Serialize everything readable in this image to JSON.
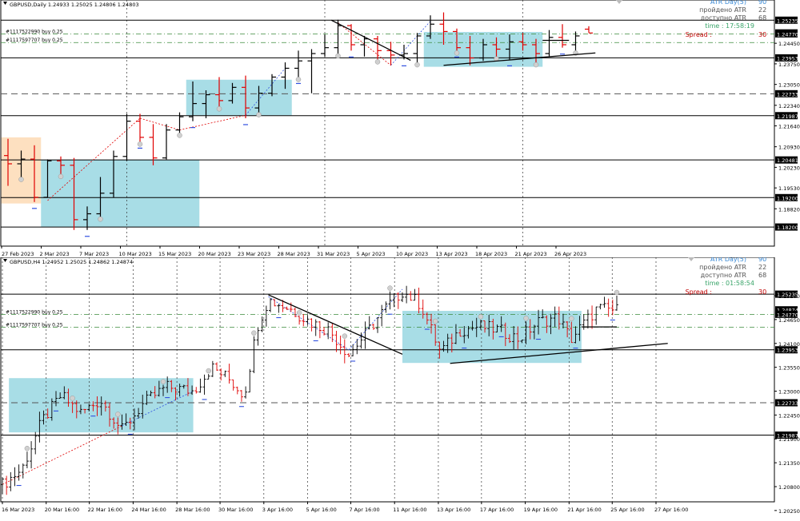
{
  "colors": {
    "bull": "#000000",
    "bear": "#e00000",
    "zone_teal": "#a8dde6",
    "zone_orange": "#fde0c0",
    "hline_solid": "#000000",
    "hline_dash": "#555555",
    "hline_green_dashdot": "#3a8a3a",
    "price_label_bg": "#000000",
    "atr_blue": "#3a8ad6",
    "time_green": "#3aa56a",
    "spread_red": "#c00000",
    "grid": "#333333"
  },
  "pane_top": {
    "title": "GBPUSD,Daily  1.24933 1.25025 1.24806 1.24803",
    "orders": [
      "#1117522990 buy 0.25",
      "#1117597707 buy 0.25"
    ],
    "info": {
      "atr_label": "ATR Day(5)",
      "atr_value": "90",
      "passed_label": "пройдено ATR",
      "passed_value": "22",
      "avail_label": "доступно ATR",
      "avail_value": "68",
      "time_text": "time : 17:58:19",
      "spread_label": "Spread :",
      "spread_value": "30"
    },
    "price_min": 1.1755,
    "price_max": 1.2565,
    "price_ticks": [
      "1.24450",
      "1.23750",
      "1.23050",
      "1.22340",
      "1.21640",
      "1.20930",
      "1.20230",
      "1.19530",
      "1.18820"
    ],
    "price_labels": [
      {
        "price": 1.25235,
        "text": "1.25235"
      },
      {
        "price": 1.24803,
        "text": "1.24803"
      },
      {
        "price": 1.2477,
        "text": "1.24770"
      },
      {
        "price": 1.23953,
        "text": "1.23953"
      },
      {
        "price": 1.22733,
        "text": "1.22733"
      },
      {
        "price": 1.21987,
        "text": "1.21987"
      },
      {
        "price": 1.20481,
        "text": "1.20481"
      },
      {
        "price": 1.192,
        "text": "1.19200"
      },
      {
        "price": 1.182,
        "text": "1.18200"
      }
    ],
    "hlines": [
      {
        "price": 1.25235,
        "style": "solid"
      },
      {
        "price": 1.23953,
        "style": "solid"
      },
      {
        "price": 1.22733,
        "style": "dash"
      },
      {
        "price": 1.21987,
        "style": "solid"
      },
      {
        "price": 1.20481,
        "style": "solid"
      },
      {
        "price": 1.192,
        "style": "solid"
      },
      {
        "price": 1.182,
        "style": "solid"
      },
      {
        "price": 1.2477,
        "style": "dashdot"
      },
      {
        "price": 1.24475,
        "style": "dashdot"
      }
    ],
    "date_labels": [
      "27 Feb 2023",
      "2 Mar 2023",
      "7 Mar 2023",
      "10 Mar 2023",
      "15 Mar 2023",
      "20 Mar 2023",
      "23 Mar 2023",
      "28 Mar 2023",
      "31 Mar 2023",
      "5 Apr 2023",
      "10 Apr 2023",
      "13 Apr 2023",
      "18 Apr 2023",
      "21 Apr 2023",
      "26 Apr 2023"
    ],
    "date_label_bar": [
      0,
      3,
      6,
      9,
      12,
      15,
      18,
      21,
      24,
      27,
      30,
      33,
      36,
      39,
      42
    ],
    "vgrid_bars": [
      9,
      24,
      39
    ],
    "bar_count": 45,
    "zones": [
      {
        "type": "orange",
        "b0": -0.5,
        "b1": 2.5,
        "p0": 1.2125,
        "p1": 1.19
      },
      {
        "type": "teal",
        "b0": 2.5,
        "b1": 14.5,
        "p0": 1.2048,
        "p1": 1.182
      },
      {
        "type": "teal",
        "b0": 13.5,
        "b1": 21.5,
        "p0": 1.2321,
        "p1": 1.22
      },
      {
        "type": "teal",
        "b0": 31.5,
        "b1": 40.5,
        "p0": 1.24835,
        "p1": 1.2365
      }
    ],
    "trendlines": [
      {
        "b0": 24.5,
        "p0": 1.25235,
        "b1": 30.5,
        "p1": 1.2387
      },
      {
        "b0": 33,
        "p0": 1.237,
        "b1": 44.5,
        "p1": 1.2412
      },
      {
        "b0": 40.5,
        "p0": 1.2455,
        "b1": 42.5,
        "p1": 1.2455
      }
    ],
    "dotted_lines": [
      {
        "b0": 3,
        "p0": 1.191,
        "b1": 10,
        "p1": 1.219,
        "color": "#e00000"
      },
      {
        "b0": 10,
        "p0": 1.219,
        "b1": 13,
        "p1": 1.215,
        "color": "#e00000"
      },
      {
        "b0": 13,
        "p0": 1.215,
        "b1": 18,
        "p1": 1.22,
        "color": "#e00000"
      },
      {
        "b0": 18,
        "p0": 1.22,
        "b1": 21,
        "p1": 1.236,
        "color": "#3050e0"
      },
      {
        "b0": 25,
        "p0": 1.2515,
        "b1": 29,
        "p1": 1.237,
        "color": "#e00000"
      },
      {
        "b0": 29,
        "p0": 1.237,
        "b1": 32,
        "p1": 1.252,
        "color": "#3050e0"
      }
    ],
    "candles": [
      [
        1.2063,
        1.212,
        1.196,
        1.2035
      ],
      [
        1.2035,
        1.208,
        1.199,
        1.2051
      ],
      [
        1.2051,
        1.2098,
        1.1905,
        1.1921
      ],
      [
        1.1921,
        1.205,
        1.192,
        1.2045
      ],
      [
        1.2045,
        1.206,
        1.2,
        1.203
      ],
      [
        1.203,
        1.2055,
        1.181,
        1.1845
      ],
      [
        1.1845,
        1.189,
        1.181,
        1.1865
      ],
      [
        1.1865,
        1.199,
        1.1855,
        1.1935
      ],
      [
        1.1935,
        1.208,
        1.192,
        1.206
      ],
      [
        1.206,
        1.2205,
        1.2045,
        1.218
      ],
      [
        1.218,
        1.2205,
        1.211,
        1.2125
      ],
      [
        1.2125,
        1.217,
        1.203,
        1.2055
      ],
      [
        1.2055,
        1.217,
        1.205,
        1.215
      ],
      [
        1.215,
        1.221,
        1.214,
        1.2195
      ],
      [
        1.2195,
        1.2315,
        1.218,
        1.224
      ],
      [
        1.224,
        1.2285,
        1.219,
        1.227
      ],
      [
        1.227,
        1.233,
        1.223,
        1.225
      ],
      [
        1.225,
        1.231,
        1.224,
        1.2295
      ],
      [
        1.2295,
        1.2335,
        1.219,
        1.2225
      ],
      [
        1.2225,
        1.23,
        1.221,
        1.2275
      ],
      [
        1.2275,
        1.234,
        1.2265,
        1.233
      ],
      [
        1.233,
        1.238,
        1.229,
        1.236
      ],
      [
        1.236,
        1.242,
        1.233,
        1.2385
      ],
      [
        1.2385,
        1.2425,
        1.2275,
        1.241
      ],
      [
        1.241,
        1.2475,
        1.24,
        1.243
      ],
      [
        1.243,
        1.2525,
        1.241,
        1.2505
      ],
      [
        1.2505,
        1.251,
        1.242,
        1.244
      ],
      [
        1.244,
        1.247,
        1.24,
        1.246
      ],
      [
        1.246,
        1.247,
        1.239,
        1.242
      ],
      [
        1.242,
        1.245,
        1.237,
        1.2405
      ],
      [
        1.2405,
        1.244,
        1.239,
        1.241
      ],
      [
        1.241,
        1.248,
        1.238,
        1.247
      ],
      [
        1.247,
        1.254,
        1.246,
        1.251
      ],
      [
        1.251,
        1.255,
        1.244,
        1.2485
      ],
      [
        1.2485,
        1.2495,
        1.242,
        1.243
      ],
      [
        1.243,
        1.247,
        1.237,
        1.2395
      ],
      [
        1.2395,
        1.246,
        1.2385,
        1.244
      ],
      [
        1.244,
        1.2465,
        1.24,
        1.2425
      ],
      [
        1.2425,
        1.2475,
        1.239,
        1.245
      ],
      [
        1.245,
        1.248,
        1.242,
        1.244
      ],
      [
        1.244,
        1.246,
        1.238,
        1.241
      ],
      [
        1.241,
        1.249,
        1.24,
        1.2465
      ],
      [
        1.2465,
        1.251,
        1.243,
        1.244
      ],
      [
        1.244,
        1.2485,
        1.242,
        1.247
      ],
      [
        1.2493,
        1.2503,
        1.2481,
        1.248
      ]
    ]
  },
  "pane_bottom": {
    "title": "GBPUSD,H4  1.24952 1.25025 1.24862 1.24874",
    "orders": [
      "#1117522990 buy 0.25",
      "#1117597707 buy 0.25"
    ],
    "info": {
      "atr_label": "ATR Day(5)",
      "atr_value": "90",
      "passed_label": "пройдено ATR",
      "passed_value": "22",
      "avail_label": "доступно ATR",
      "avail_value": "68",
      "time_text": "time : 01:58:54",
      "spread_label": "Spread :",
      "spread_value": "30"
    },
    "price_min": 1.2045,
    "price_max": 1.259,
    "price_ticks": [
      "1.25200",
      "1.24650",
      "1.24100",
      "1.23550",
      "1.23000",
      "1.22450",
      "1.21900",
      "1.21350",
      "1.20800",
      "1.20250"
    ],
    "price_labels": [
      {
        "price": 1.25235,
        "text": "1.25235"
      },
      {
        "price": 1.24874,
        "text": "1.24874"
      },
      {
        "price": 1.2477,
        "text": "1.24770"
      },
      {
        "price": 1.23953,
        "text": "1.23953"
      },
      {
        "price": 1.22733,
        "text": "1.22733"
      },
      {
        "price": 1.21987,
        "text": "1.21987"
      }
    ],
    "hlines": [
      {
        "price": 1.25235,
        "style": "solid"
      },
      {
        "price": 1.23953,
        "style": "solid"
      },
      {
        "price": 1.22733,
        "style": "dash"
      },
      {
        "price": 1.21987,
        "style": "solid"
      },
      {
        "price": 1.2477,
        "style": "dashdot"
      },
      {
        "price": 1.24475,
        "style": "dashdot"
      }
    ],
    "date_labels": [
      "16 Mar 2023",
      "20 Mar 16:00",
      "22 Mar 16:00",
      "24 Mar 16:00",
      "28 Mar 16:00",
      "30 Mar 16:00",
      "3 Apr 16:00",
      "5 Apr 16:00",
      "7 Apr 16:00",
      "11 Apr 16:00",
      "13 Apr 16:00",
      "17 Apr 16:00",
      "19 Apr 16:00",
      "21 Apr 16:00",
      "25 Apr 16:00",
      "27 Apr 16:00"
    ],
    "vgrid_fracs": [
      0.0,
      0.067,
      0.133,
      0.2,
      0.267,
      0.333,
      0.4,
      0.467,
      0.533,
      0.6,
      0.667,
      0.733,
      0.8,
      0.867,
      0.933,
      1.0
    ],
    "zones": [
      {
        "x0": 0.01,
        "x1": 0.292,
        "p0": 1.233,
        "p1": 1.2205
      },
      {
        "x0": 0.612,
        "x1": 0.886,
        "p0": 1.2485,
        "p1": 1.2365
      }
    ],
    "trendlines": [
      {
        "x0": 0.407,
        "p0": 1.2522,
        "x1": 0.612,
        "p1": 1.2385
      },
      {
        "x0": 0.685,
        "p0": 1.2364,
        "x1": 1.018,
        "p1": 1.241
      }
    ],
    "dotted_lines": [
      {
        "x0": 0.0,
        "p0": 1.2085,
        "x1": 0.183,
        "p1": 1.222,
        "color": "#e00000"
      },
      {
        "x0": 0.183,
        "p0": 1.222,
        "x1": 0.292,
        "p1": 1.23,
        "color": "#3050e0"
      },
      {
        "x0": 0.407,
        "p0": 1.2518,
        "x1": 0.53,
        "p1": 1.2395,
        "color": "#3050e0"
      },
      {
        "x0": 0.53,
        "p0": 1.2395,
        "x1": 0.612,
        "p1": 1.2535,
        "color": "#3050e0"
      }
    ],
    "series_anchors": [
      [
        0.0,
        1.2085
      ],
      [
        0.03,
        1.212
      ],
      [
        0.06,
        1.223
      ],
      [
        0.09,
        1.229
      ],
      [
        0.12,
        1.225
      ],
      [
        0.15,
        1.228
      ],
      [
        0.183,
        1.221
      ],
      [
        0.215,
        1.227
      ],
      [
        0.25,
        1.231
      ],
      [
        0.292,
        1.23
      ],
      [
        0.32,
        1.2355
      ],
      [
        0.345,
        1.233
      ],
      [
        0.37,
        1.229
      ],
      [
        0.39,
        1.245
      ],
      [
        0.407,
        1.251
      ],
      [
        0.44,
        1.249
      ],
      [
        0.47,
        1.246
      ],
      [
        0.5,
        1.244
      ],
      [
        0.53,
        1.2385
      ],
      [
        0.56,
        1.244
      ],
      [
        0.585,
        1.249
      ],
      [
        0.612,
        1.253
      ],
      [
        0.64,
        1.25
      ],
      [
        0.67,
        1.239
      ],
      [
        0.7,
        1.244
      ],
      [
        0.73,
        1.245
      ],
      [
        0.76,
        1.244
      ],
      [
        0.79,
        1.242
      ],
      [
        0.82,
        1.246
      ],
      [
        0.85,
        1.247
      ],
      [
        0.87,
        1.242
      ],
      [
        0.886,
        1.245
      ],
      [
        0.91,
        1.249
      ],
      [
        0.94,
        1.2487
      ]
    ]
  }
}
